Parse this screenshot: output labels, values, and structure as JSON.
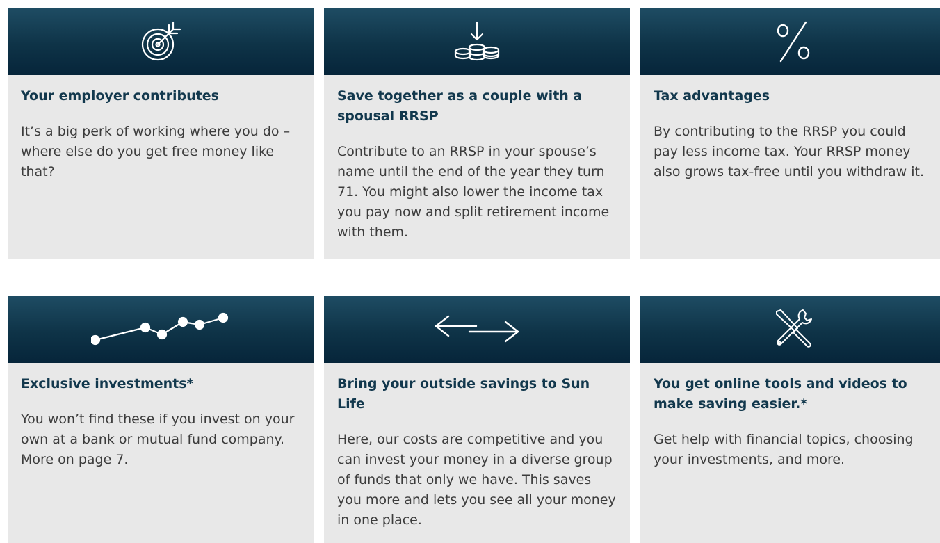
{
  "cards": [
    {
      "icon": "target-icon",
      "title": "Your employer contributes",
      "text": "It’s a big perk of working where you do – where else do you get free money like that?"
    },
    {
      "icon": "coins-deposit-icon",
      "title": "Save together as a couple with a spousal RRSP",
      "text": "Contribute to an RRSP in your spouse’s name until the end of the year they turn 71. You might also lower the income tax you pay now and split retirement income with them."
    },
    {
      "icon": "percent-icon",
      "title": "Tax advantages",
      "text": "By contributing to the RRSP you could pay less income tax. Your RRSP money also grows tax-free until you withdraw it."
    },
    {
      "icon": "line-chart-icon",
      "title": "Exclusive investments*",
      "text": "You won’t find these if you invest on your own at a bank or mutual fund company. More on page 7."
    },
    {
      "icon": "transfer-arrows-icon",
      "title": "Bring your outside savings to Sun Life",
      "text": "Here, our costs are competitive and you can invest your money in a diverse group of funds that only we have. This saves you more and lets you see all your money in one place."
    },
    {
      "icon": "tools-icon",
      "title": "You get online tools and videos to make saving easier.*",
      "text": "Get help with financial topics, choosing your investments, and more."
    }
  ],
  "colors": {
    "banner_top": "#1e4c63",
    "banner_bottom": "#06253a",
    "card_bg": "#e8e8e8",
    "title": "#12384d"
  }
}
